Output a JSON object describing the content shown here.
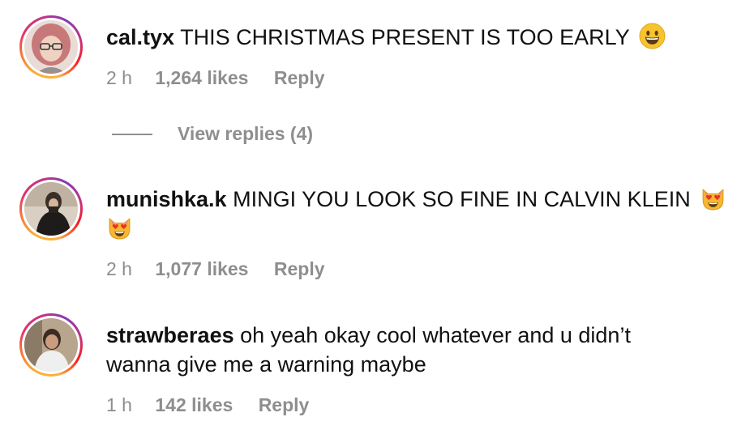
{
  "comments": [
    {
      "username": "cal.tyx",
      "text": "THIS CHRISTMAS PRESENT IS TOO EARLY",
      "emoji": "grinning-face",
      "time": "2 h",
      "likes": "1,264 likes",
      "reply": "Reply"
    },
    {
      "username": "munishka.k",
      "text": "MINGI YOU LOOK SO FINE IN CALVIN KLEIN",
      "emoji": "smiling-cat-heart-eyes",
      "time": "2 h",
      "likes": "1,077 likes",
      "reply": "Reply"
    },
    {
      "username": "strawberaes",
      "text": "oh yeah okay cool whatever and u didn’t wanna give me a warning maybe",
      "time": "1 h",
      "likes": "142 likes",
      "reply": "Reply"
    }
  ],
  "view_replies": "View replies (4)",
  "colors": {
    "text": "#111111",
    "meta": "#8e8e8e",
    "story_ring": [
      "#fcaf45",
      "#f77737",
      "#e1306c",
      "#c13584",
      "#833ab4"
    ]
  }
}
